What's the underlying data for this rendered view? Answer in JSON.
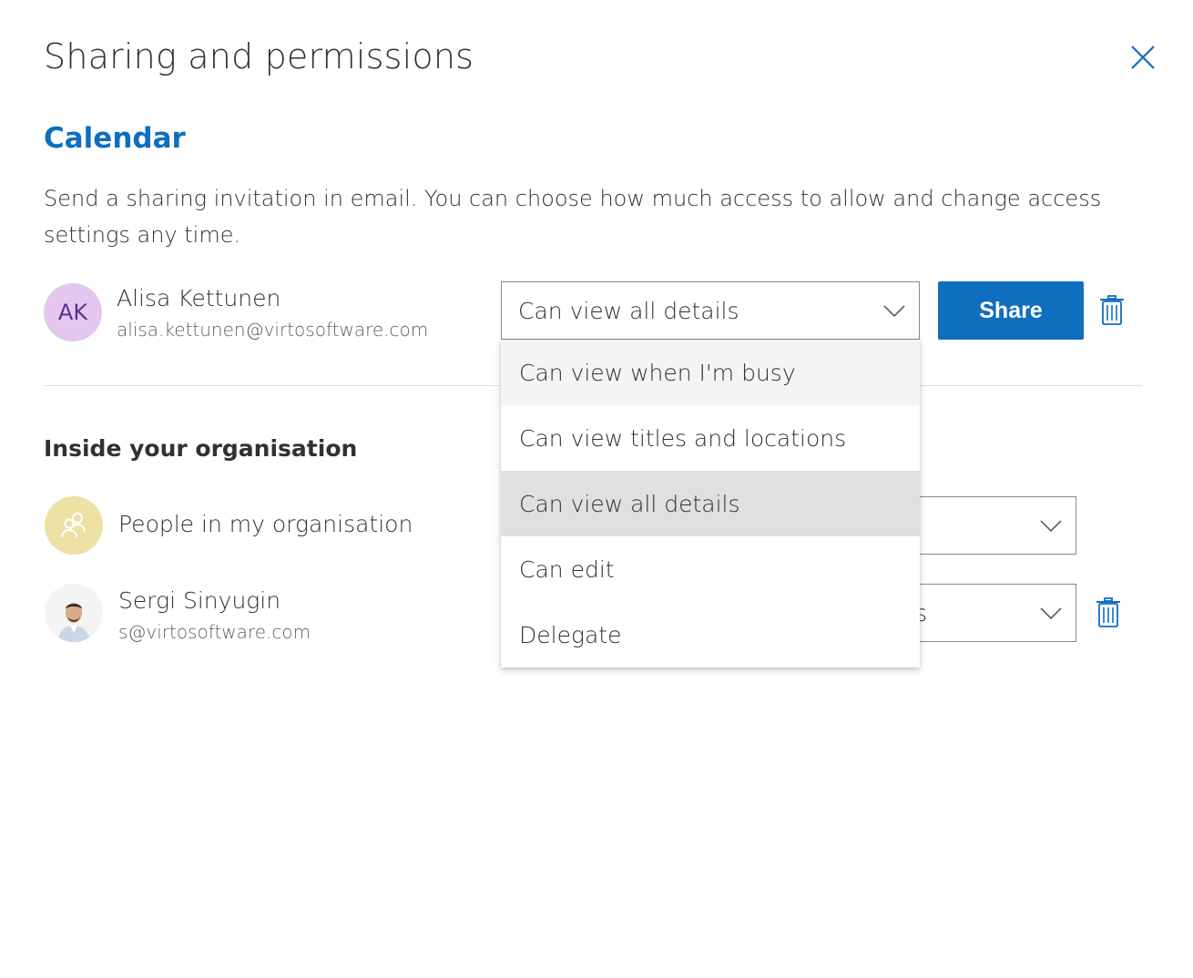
{
  "dialog": {
    "title": "Sharing and permissions",
    "close_icon": "close-icon"
  },
  "calendar": {
    "name": "Calendar",
    "description": "Send a sharing invitation in email. You can choose how much access to allow and change access settings any time."
  },
  "invitee": {
    "initials": "AK",
    "name": "Alisa Kettunen",
    "email": "alisa.kettunen@virtosoftware.com",
    "permission": "Can view all details",
    "share_label": "Share"
  },
  "permission_options": [
    {
      "label": "Can view when I'm busy",
      "state": "hover"
    },
    {
      "label": "Can view titles and locations",
      "state": "normal"
    },
    {
      "label": "Can view all details",
      "state": "selected"
    },
    {
      "label": "Can edit",
      "state": "normal"
    },
    {
      "label": "Delegate",
      "state": "normal"
    }
  ],
  "inside_org": {
    "label": "Inside your organisation",
    "org_group": {
      "name": "People in my organisation",
      "icon": "people-icon",
      "permission": ""
    },
    "member": {
      "name": "Sergi Sinyugin",
      "email": "s@virtosoftware.com",
      "permission_partial": "s"
    }
  },
  "colors": {
    "accent": "#106ebe",
    "avatar_ak_bg": "#e4c7ef",
    "avatar_ak_fg": "#5c2e91",
    "avatar_org_bg": "#ede1a3",
    "selected_option_bg": "#e0e0e0",
    "hover_option_bg": "#f4f4f4"
  }
}
